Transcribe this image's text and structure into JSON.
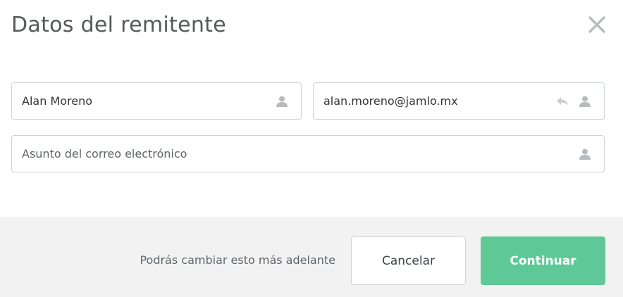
{
  "dialog": {
    "title": "Datos del remitente",
    "close_icon": "close-icon"
  },
  "form": {
    "name": {
      "value": "Alan Moreno",
      "icon": "user-icon"
    },
    "email": {
      "value": "alan.moreno@jamlo.mx",
      "icons": [
        "reply-icon",
        "user-icon"
      ]
    },
    "subject": {
      "value": "",
      "placeholder": "Asunto del correo electrónico",
      "icon": "user-icon"
    }
  },
  "footer": {
    "hint": "Podrás cambiar esto más adelante",
    "cancel_label": "Cancelar",
    "continue_label": "Continuar"
  },
  "colors": {
    "accent": "#5ec996",
    "footer_bg": "#f2f2f2",
    "border": "#cfd3d6",
    "icon": "#b9bcbe"
  }
}
